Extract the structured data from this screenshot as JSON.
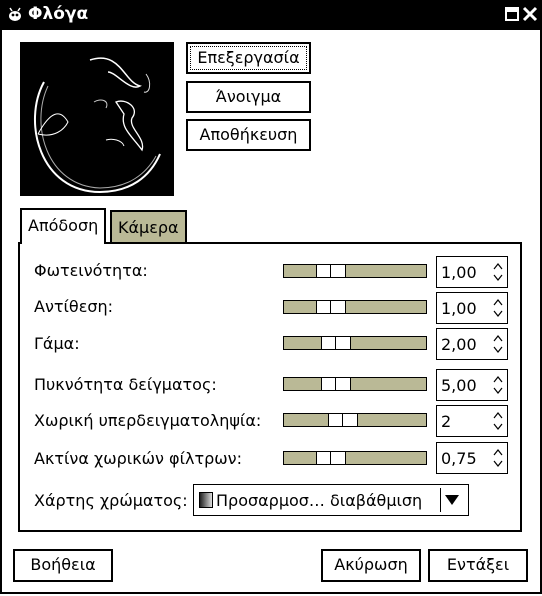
{
  "window": {
    "title": "Φλόγα"
  },
  "actions": {
    "edit": "Επεξεργασία",
    "open": "Άνοιγμα",
    "save": "Αποθήκευση"
  },
  "tabs": [
    {
      "label": "Απόδοση"
    },
    {
      "label": "Κάμερα"
    }
  ],
  "render": {
    "brightness": {
      "label": "Φωτεινότητα:",
      "value": "1,00",
      "slider_fraction": 0.23
    },
    "contrast": {
      "label": "Αντίθεση:",
      "value": "1,00",
      "slider_fraction": 0.23
    },
    "gamma": {
      "label": "Γάμα:",
      "value": "2,00",
      "slider_fraction": 0.28
    },
    "sample_density": {
      "label": "Πυκνότητα δείγματος:",
      "value": "5,00",
      "slider_fraction": 0.28
    },
    "spatial_oversample": {
      "label": "Χωρική υπερδειγματοληψία:",
      "value": "2",
      "slider_fraction": 0.34
    },
    "spatial_filter_radius": {
      "label": "Ακτίνα χωρικών φίλτρων:",
      "value": "0,75",
      "slider_fraction": 0.23
    },
    "colormap": {
      "label": "Χάρτης χρώματος:",
      "value": "Προσαρμοσ… διαβάθμιση"
    }
  },
  "dialog_buttons": {
    "help": "Βοήθεια",
    "cancel": "Ακύρωση",
    "ok": "Εντάξει"
  },
  "colors": {
    "titlebar": "#000000",
    "slider_trough": "#bab996",
    "inactive_tab": "#bab996"
  }
}
